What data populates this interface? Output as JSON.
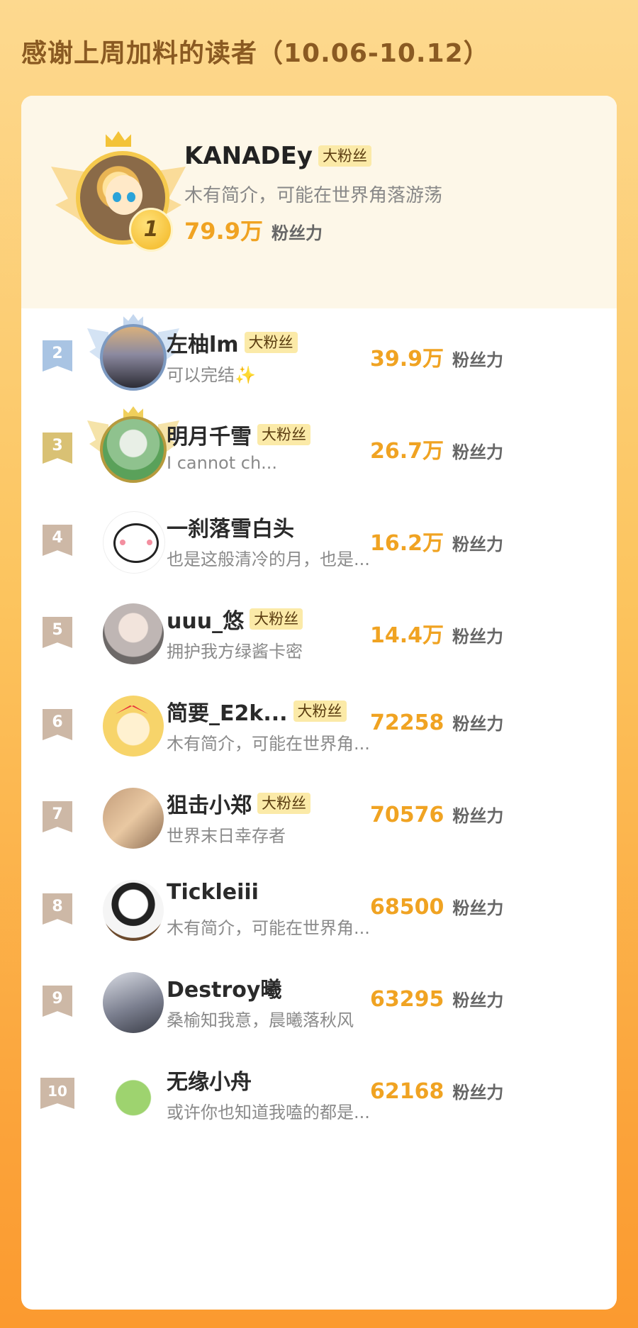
{
  "header": {
    "title": "感谢上周加料的读者（10.06-10.12）"
  },
  "top1": {
    "rank": "1",
    "name": "KANADEy",
    "badge": "大粉丝",
    "bio": "木有简介，可能在世界角落游荡",
    "score": "79.9万",
    "unit": "粉丝力"
  },
  "rows": [
    {
      "rank": "2",
      "name": "左柚lm",
      "badge": "大粉丝",
      "bio": "可以完结✨",
      "score": "39.9万",
      "unit": "粉丝力"
    },
    {
      "rank": "3",
      "name": "明月千雪",
      "badge": "大粉丝",
      "bio": "I cannot ch...",
      "score": "26.7万",
      "unit": "粉丝力"
    },
    {
      "rank": "4",
      "name": "一刹落雪白头",
      "badge": "",
      "bio": "也是这般清冷的月，也是...",
      "score": "16.2万",
      "unit": "粉丝力"
    },
    {
      "rank": "5",
      "name": "uuu_悠",
      "badge": "大粉丝",
      "bio": "拥护我方绿酱卡密",
      "score": "14.4万",
      "unit": "粉丝力"
    },
    {
      "rank": "6",
      "name": "简要_E2k...",
      "badge": "大粉丝",
      "bio": "木有简介，可能在世界角...",
      "score": "72258",
      "unit": "粉丝力"
    },
    {
      "rank": "7",
      "name": "狙击小郑",
      "badge": "大粉丝",
      "bio": "世界末日幸存者",
      "score": "70576",
      "unit": "粉丝力"
    },
    {
      "rank": "8",
      "name": "Tickleiii",
      "badge": "",
      "bio": "木有简介，可能在世界角...",
      "score": "68500",
      "unit": "粉丝力"
    },
    {
      "rank": "9",
      "name": "Destroy曦",
      "badge": "",
      "bio": "桑榆知我意，晨曦落秋风",
      "score": "63295",
      "unit": "粉丝力"
    },
    {
      "rank": "10",
      "name": "无缘小舟",
      "badge": "",
      "bio": "或许你也知道我嗑的都是...",
      "score": "62168",
      "unit": "粉丝力"
    }
  ],
  "colors": {
    "accent": "#f0a322",
    "badge_bg": "#fbeaa8",
    "title": "#8a5a22"
  },
  "icons": {
    "crown": "crown-icon",
    "wings": "wings-icon",
    "rank_flag": "rank-flag-icon",
    "sparkle": "sparkle-icon"
  }
}
